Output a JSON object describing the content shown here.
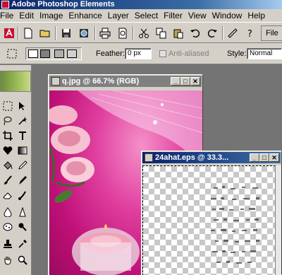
{
  "app": {
    "title": "Adobe Photoshop Elements"
  },
  "menu": [
    "File",
    "Edit",
    "Image",
    "Enhance",
    "Layer",
    "Select",
    "Filter",
    "View",
    "Window",
    "Help"
  ],
  "toolbar": {
    "icons": [
      "adobe-logo-icon",
      "new-document-icon",
      "open-folder-icon",
      "save-icon",
      "save-for-web-icon",
      "print-icon",
      "print-preview-icon",
      "cut-icon",
      "copy-icon",
      "paste-icon",
      "undo-icon",
      "redo-icon",
      "help-icon",
      "search-help-icon"
    ],
    "file_browser_label": "File"
  },
  "options": {
    "feather_label": "Feather:",
    "feather_value": "0 px",
    "anti_aliased_label": "Anti-aliased",
    "style_label": "Style:",
    "style_value": "Normal"
  },
  "documents": [
    {
      "title": "q.jpg @ 66.7% (RGB)",
      "active": false
    },
    {
      "title": "24ahat.eps @ 33.3...",
      "active": true
    }
  ],
  "window_buttons": {
    "minimize": "_",
    "maximize": "□",
    "close": "✕"
  },
  "colors": {
    "title_active": "#0a246a",
    "title_inactive": "#808080",
    "chrome": "#d4d0c8",
    "workspace": "#747474"
  }
}
